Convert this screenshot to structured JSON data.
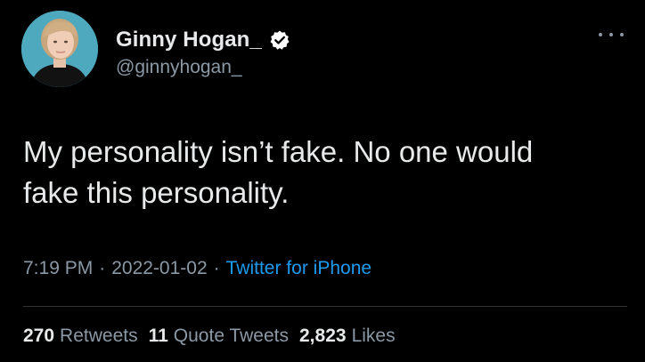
{
  "user": {
    "display_name": "Ginny Hogan_",
    "handle": "@ginnyhogan_",
    "verified_icon": "verified-badge-icon"
  },
  "tweet": {
    "text": "My personality isn’t fake. No one would\nfake this personality.",
    "time": "7:19 PM",
    "date": "2022-01-02",
    "separator": "·",
    "source": "Twitter for iPhone"
  },
  "stats": {
    "retweets_count": "270",
    "retweets_label": "Retweets",
    "quotes_count": "11",
    "quotes_label": "Quote Tweets",
    "likes_count": "2,823",
    "likes_label": "Likes"
  },
  "colors": {
    "background": "#000000",
    "text": "#e7e9ea",
    "secondary": "#8b98a5",
    "accent": "#1d9bf0"
  }
}
